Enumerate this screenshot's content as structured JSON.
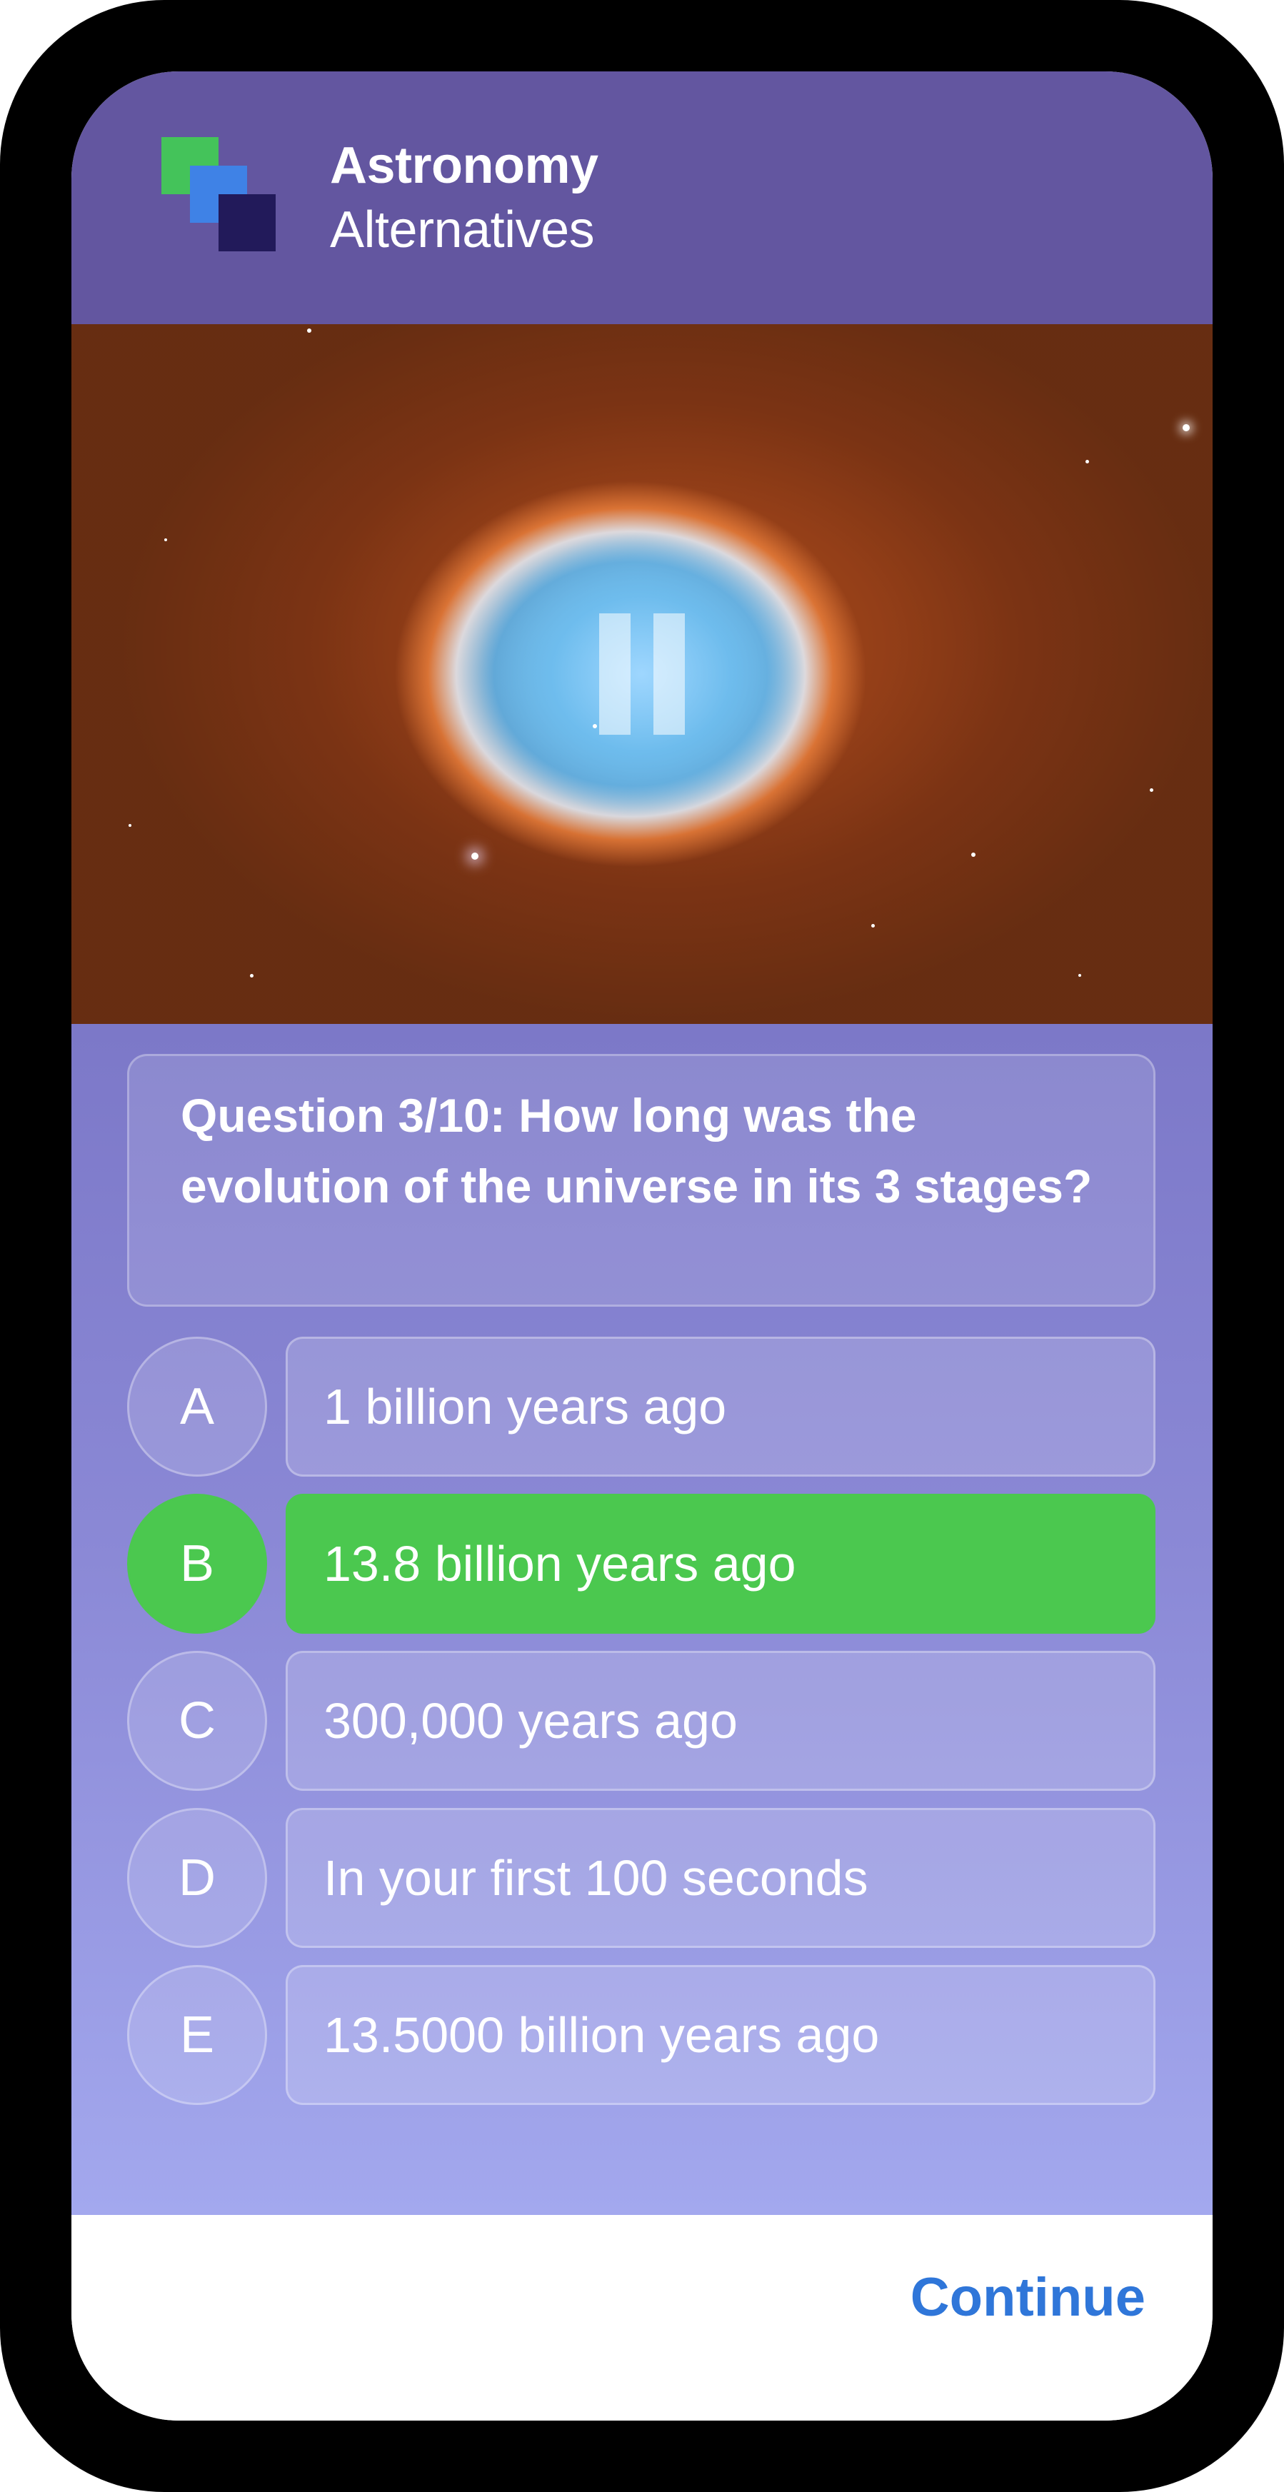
{
  "header": {
    "brand_line1": "Astronomy",
    "brand_line2": "Alternatives",
    "logo_colors": [
      "#44c35a",
      "#3f82e6",
      "#221a5a"
    ]
  },
  "media": {
    "description_icon": "pause-icon"
  },
  "question": {
    "text": "Question 3/10: How long was the evolution of the universe in its 3 stages?"
  },
  "options": [
    {
      "letter": "A",
      "text": "1 billion years ago",
      "selected": false
    },
    {
      "letter": "B",
      "text": "13.8 billion years ago",
      "selected": true
    },
    {
      "letter": "C",
      "text": "300,000 years ago",
      "selected": false
    },
    {
      "letter": "D",
      "text": "In your first 100 seconds",
      "selected": false
    },
    {
      "letter": "E",
      "text": "13.5000 billion years ago",
      "selected": false
    }
  ],
  "footer": {
    "continue_label": "Continue"
  },
  "colors": {
    "header_bg": "#6356a0",
    "selected": "#4bc84f",
    "accent": "#2f76d9"
  }
}
